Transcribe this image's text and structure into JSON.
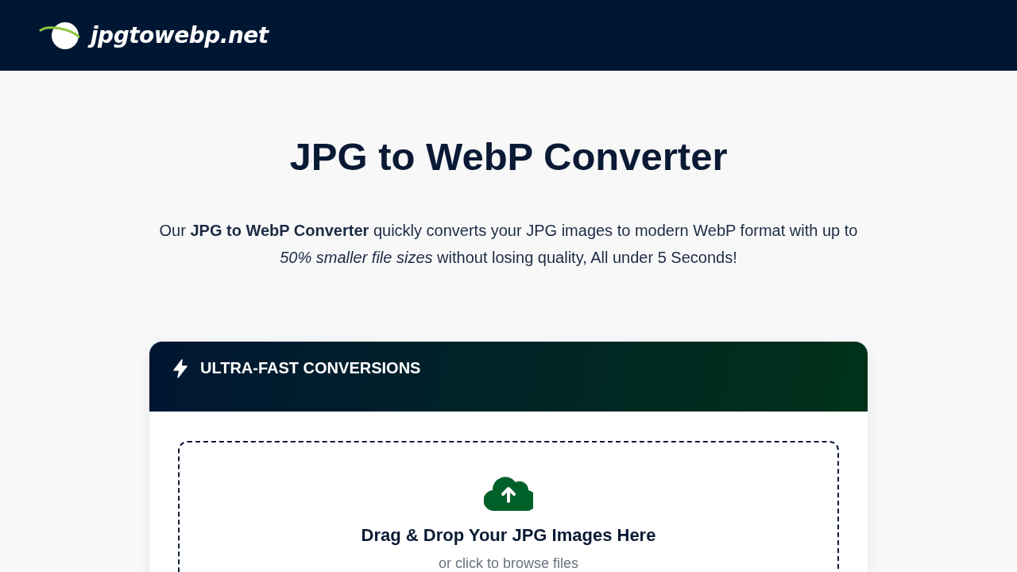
{
  "header": {
    "logo_text": "jpgtowebp.net"
  },
  "hero": {
    "title": "JPG to WebP Converter",
    "description": "Our **JPG to WebP Converter** quickly converts your JPG images to modern WebP format with up to *50% smaller file sizes* without losing quality, All under 5 Seconds!"
  },
  "converter": {
    "banner": "ULTRA-FAST CONVERSIONS",
    "dropzone": {
      "heading": "Drag & Drop Your JPG Images Here",
      "hint": "or click to browse files"
    }
  }
}
